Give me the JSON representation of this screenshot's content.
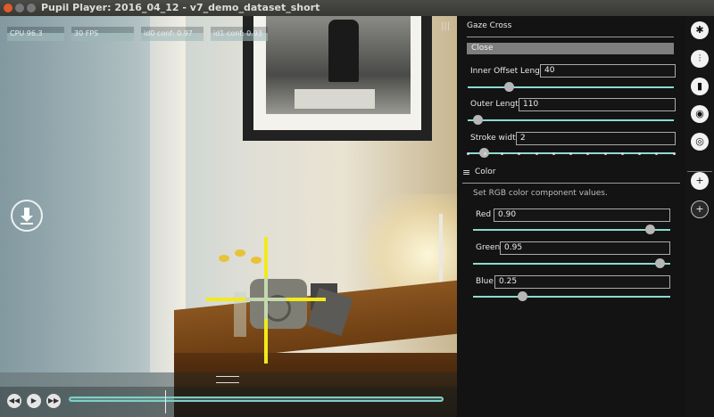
{
  "window": {
    "title": "Pupil Player: 2016_04_12 - v7_demo_dataset_short"
  },
  "hud": {
    "cpu": "CPU 96.3",
    "fps": "30 FPS",
    "id0": "id0 conf: 0.97",
    "id1": "id1 conf: 0.93",
    "menu_glyph": "|||"
  },
  "playback": {
    "icons": [
      "rewind-icon",
      "play-icon",
      "fast-forward-icon"
    ]
  },
  "panel": {
    "title": "Gaze Cross",
    "close_label": "Close",
    "inner_offset": {
      "label": "Inner Offset Length",
      "value": "40",
      "fraction": 0.2
    },
    "outer_length": {
      "label": "Outer Length",
      "value": "110",
      "fraction": 0.05
    },
    "stroke_width": {
      "label": "Stroke width",
      "value": "2",
      "fraction": 0.08
    },
    "color": {
      "menu_glyph": "≡",
      "title": "Color",
      "description": "Set RGB color component values.",
      "red": {
        "label": "Red",
        "value": "0.90",
        "fraction": 0.9
      },
      "green": {
        "label": "Green",
        "value": "0.95",
        "fraction": 0.95
      },
      "blue": {
        "label": "Blue",
        "value": "0.25",
        "fraction": 0.25
      }
    }
  },
  "colors": {
    "cross": "#f2ea1c",
    "accent": "#8adccf"
  },
  "sidebar_icons": [
    "gear-icon",
    "sliders-icon",
    "bar-chart-icon",
    "eye-icon",
    "target-icon",
    "crosshair-icon",
    "crosshair-add-icon"
  ]
}
